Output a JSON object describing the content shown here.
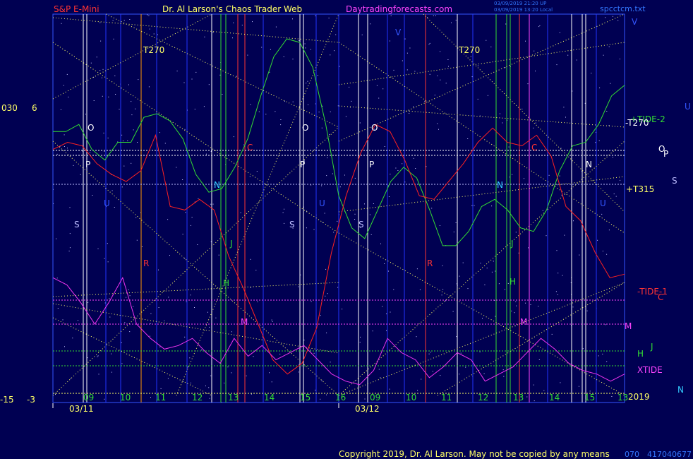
{
  "header": {
    "instrument": "S&P E-Mini",
    "site": "Dr. Al Larson's Chaos Trader Web",
    "url": "Daytradingforecasts.com",
    "stamp1": "03/09/2019 21:20 UP",
    "stamp2": "03/09/2019 13:20 Local",
    "file": "spcctcm.txt"
  },
  "footer": {
    "copyright": "Copyright 2019, Dr. Al Larson. May not be copied by any means",
    "code": "417040677",
    "code_prefix": "070"
  },
  "left_axis": {
    "top_a": "030",
    "top_b": "6",
    "bottom_a": "-15",
    "bottom_b": "-3"
  },
  "chart_data": {
    "type": "line",
    "x_hour_ticks": [
      "09",
      "10",
      "11",
      "12",
      "13",
      "14",
      "15",
      "16",
      "09",
      "10",
      "11",
      "12",
      "13",
      "14",
      "15",
      "13"
    ],
    "x_dates": [
      "03/11",
      "03/12"
    ],
    "year": "2019",
    "y_labels": {
      "top": "6",
      "bottom": "-3"
    },
    "series": [
      {
        "name": "+TIDE-2",
        "color": "#33dd33",
        "values": [
          0.74,
          0.74,
          0.76,
          0.69,
          0.66,
          0.71,
          0.71,
          0.78,
          0.79,
          0.77,
          0.72,
          0.62,
          0.57,
          0.58,
          0.64,
          0.72,
          0.84,
          0.95,
          1.0,
          0.99,
          0.92,
          0.76,
          0.56,
          0.47,
          0.44,
          0.52,
          0.6,
          0.64,
          0.61,
          0.52,
          0.42,
          0.42,
          0.46,
          0.53,
          0.55,
          0.52,
          0.47,
          0.46,
          0.52,
          0.63,
          0.7,
          0.71,
          0.76,
          0.84,
          0.87
        ]
      },
      {
        "name": "-TIDE-1",
        "color": "#ff2020",
        "values": [
          0.69,
          0.71,
          0.7,
          0.65,
          0.62,
          0.6,
          0.63,
          0.73,
          0.53,
          0.52,
          0.55,
          0.52,
          0.39,
          0.3,
          0.2,
          0.1,
          0.06,
          0.09,
          0.19,
          0.4,
          0.56,
          0.68,
          0.76,
          0.74,
          0.66,
          0.56,
          0.55,
          0.6,
          0.65,
          0.71,
          0.75,
          0.71,
          0.7,
          0.73,
          0.67,
          0.53,
          0.49,
          0.4,
          0.33,
          0.34
        ]
      },
      {
        "name": "XTIDE",
        "color": "#ee33ee",
        "values": [
          0.33,
          0.31,
          0.26,
          0.2,
          0.26,
          0.33,
          0.2,
          0.16,
          0.13,
          0.14,
          0.16,
          0.12,
          0.09,
          0.16,
          0.11,
          0.14,
          0.1,
          0.12,
          0.14,
          0.1,
          0.06,
          0.04,
          0.03,
          0.07,
          0.16,
          0.12,
          0.1,
          0.05,
          0.08,
          0.12,
          0.1,
          0.04,
          0.06,
          0.08,
          0.12,
          0.16,
          0.13,
          0.09,
          0.07,
          0.06,
          0.04,
          0.06
        ]
      }
    ],
    "flux_labels": [
      "+T315",
      "-T270",
      "T270",
      "T270"
    ],
    "planet_labels": [
      "O",
      "P",
      "S",
      "N",
      "U",
      "J",
      "H",
      "M",
      "R",
      "C",
      "V",
      "S",
      "P",
      "O",
      "U",
      "N",
      "C",
      "M",
      "H",
      "J",
      "R",
      "S",
      "P",
      "O",
      "U",
      "N"
    ],
    "right_labels": [
      "V",
      "U",
      "O",
      "P",
      "S",
      "N",
      "C",
      "M",
      "J",
      "H"
    ]
  }
}
